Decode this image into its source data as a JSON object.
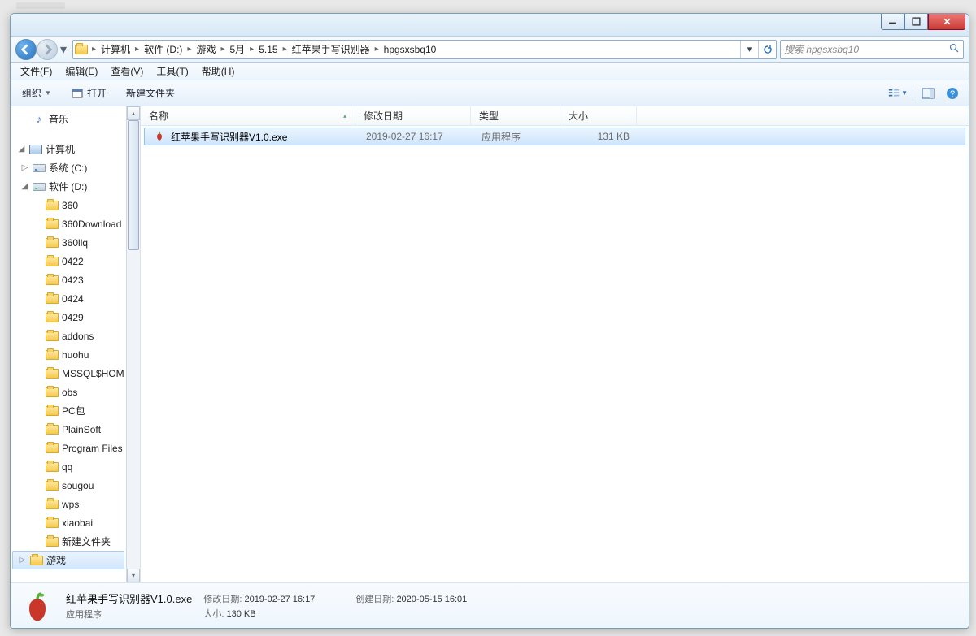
{
  "window_controls": {
    "minimize": "—",
    "maximize": "❐",
    "close": "✕"
  },
  "breadcrumb": [
    "计算机",
    "软件 (D:)",
    "游戏",
    "5月",
    "5.15",
    "红苹果手写识别器",
    "hpgsxsbq10"
  ],
  "search_placeholder": "搜索 hpgsxsbq10",
  "menubar": [
    {
      "label": "文件",
      "u": "F"
    },
    {
      "label": "编辑",
      "u": "E"
    },
    {
      "label": "查看",
      "u": "V"
    },
    {
      "label": "工具",
      "u": "T"
    },
    {
      "label": "帮助",
      "u": "H"
    }
  ],
  "toolbar": {
    "organize": "组织",
    "open": "打开",
    "newfolder": "新建文件夹"
  },
  "sidebar": {
    "music": "音乐",
    "computer": "计算机",
    "drive_c": "系统 (C:)",
    "drive_d": "软件 (D:)",
    "folders": [
      "360",
      "360Download",
      "360llq",
      "0422",
      "0423",
      "0424",
      "0429",
      "addons",
      "huohu",
      "MSSQL$HOM",
      "obs",
      "PC包",
      "PlainSoft",
      "Program Files",
      "qq",
      "sougou",
      "wps",
      "xiaobai",
      "新建文件夹",
      "游戏"
    ]
  },
  "columns": {
    "name": "名称",
    "date": "修改日期",
    "type": "类型",
    "size": "大小"
  },
  "files": [
    {
      "name": "红苹果手写识别器V1.0.exe",
      "date": "2019-02-27 16:17",
      "type": "应用程序",
      "size": "131 KB"
    }
  ],
  "details": {
    "title": "红苹果手写识别器V1.0.exe",
    "subtitle": "应用程序",
    "mod_label": "修改日期:",
    "mod_value": "2019-02-27 16:17",
    "size_label": "大小:",
    "size_value": "130 KB",
    "created_label": "创建日期:",
    "created_value": "2020-05-15 16:01"
  }
}
